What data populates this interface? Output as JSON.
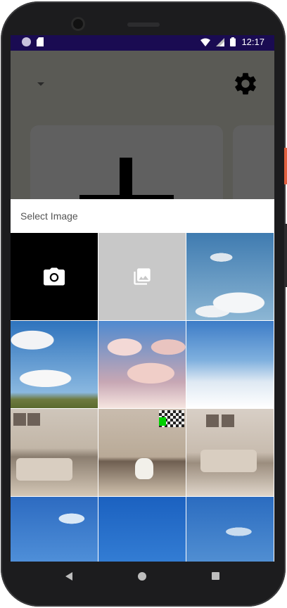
{
  "status_bar": {
    "time": "12:17",
    "left_icons": [
      "notification-circle-icon",
      "sd-card-icon"
    ],
    "right_icons": [
      "wifi-icon",
      "signal-icon",
      "battery-icon"
    ]
  },
  "app_background": {
    "icons": [
      "dropdown-arrow-icon",
      "settings-gear-icon",
      "add-plus-icon"
    ]
  },
  "sheet": {
    "title": "Select Image",
    "tiles": [
      {
        "kind": "action",
        "icon": "camera-icon"
      },
      {
        "kind": "action",
        "icon": "photo-library-icon"
      },
      {
        "kind": "image",
        "image": "sky-clouds"
      },
      {
        "kind": "image",
        "image": "sky-clouds-landscape"
      },
      {
        "kind": "image",
        "image": "pink-clouds"
      },
      {
        "kind": "image",
        "image": "above-clouds"
      },
      {
        "kind": "image",
        "image": "living-room"
      },
      {
        "kind": "image",
        "image": "room-with-dog"
      },
      {
        "kind": "image",
        "image": "living-room-2"
      },
      {
        "kind": "image",
        "image": "blue-sky"
      },
      {
        "kind": "image",
        "image": "deep-blue-sky"
      },
      {
        "kind": "image",
        "image": "blue-sky-2"
      }
    ]
  },
  "nav_bar": {
    "icons": [
      "back-icon",
      "home-icon",
      "recents-icon"
    ]
  },
  "colors": {
    "status_bar": "#1a0b52",
    "scrim": "#5a5a55",
    "camera_tile": "#000000",
    "gallery_tile": "#c8c8c8",
    "phone_frame": "#1c1c1e"
  }
}
